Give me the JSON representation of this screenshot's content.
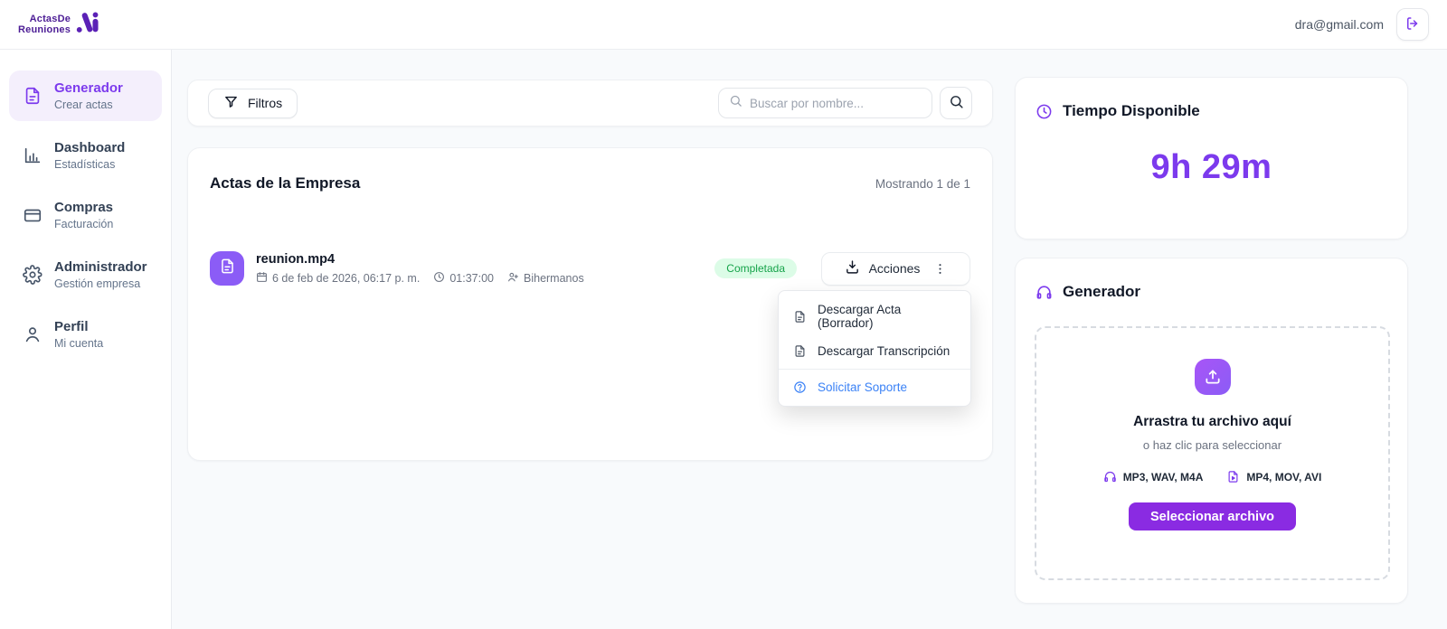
{
  "colors": {
    "accent": "#7c3aed",
    "accent_button": "#8a2be2",
    "logo_purple": "#4c1d95",
    "status_success_bg": "#dcfce7",
    "status_success_text": "#16a34a",
    "support_link": "#3b82f6",
    "page_bg": "#f8fafc"
  },
  "header": {
    "logo_line1": "ActasDe",
    "logo_line2": "Reuniones",
    "user_email": "dra@gmail.com"
  },
  "sidebar": {
    "items": [
      {
        "label": "Generador",
        "sublabel": "Crear actas",
        "icon": "document-icon",
        "active": true
      },
      {
        "label": "Dashboard",
        "sublabel": "Estadísticas",
        "icon": "bar-chart-icon",
        "active": false
      },
      {
        "label": "Compras",
        "sublabel": "Facturación",
        "icon": "credit-card-icon",
        "active": false
      },
      {
        "label": "Administrador",
        "sublabel": "Gestión empresa",
        "icon": "gear-icon",
        "active": false
      },
      {
        "label": "Perfil",
        "sublabel": "Mi cuenta",
        "icon": "user-icon",
        "active": false
      }
    ]
  },
  "toolbar": {
    "filters_label": "Filtros",
    "search_placeholder": "Buscar por nombre..."
  },
  "list": {
    "title": "Actas de la Empresa",
    "count_label": "Mostrando 1 de 1",
    "rows": [
      {
        "name": "reunion.mp4",
        "date": "6 de feb de 2026, 06:17 p. m.",
        "duration": "01:37:00",
        "owner": "Bihermanos",
        "status": "Completada",
        "actions_label": "Acciones"
      }
    ]
  },
  "actions_menu": {
    "items": [
      {
        "label": "Descargar Acta (Borrador)"
      },
      {
        "label": "Descargar Transcripción"
      }
    ],
    "support_label": "Solicitar Soporte"
  },
  "time_card": {
    "title": "Tiempo Disponible",
    "value": "9h 29m"
  },
  "generator_card": {
    "title": "Generador",
    "dropzone_title": "Arrastra tu archivo aquí",
    "dropzone_subtitle": "o haz clic para seleccionar",
    "audio_formats": "MP3, WAV, M4A",
    "video_formats": "MP4, MOV, AVI",
    "button_label": "Seleccionar archivo"
  }
}
